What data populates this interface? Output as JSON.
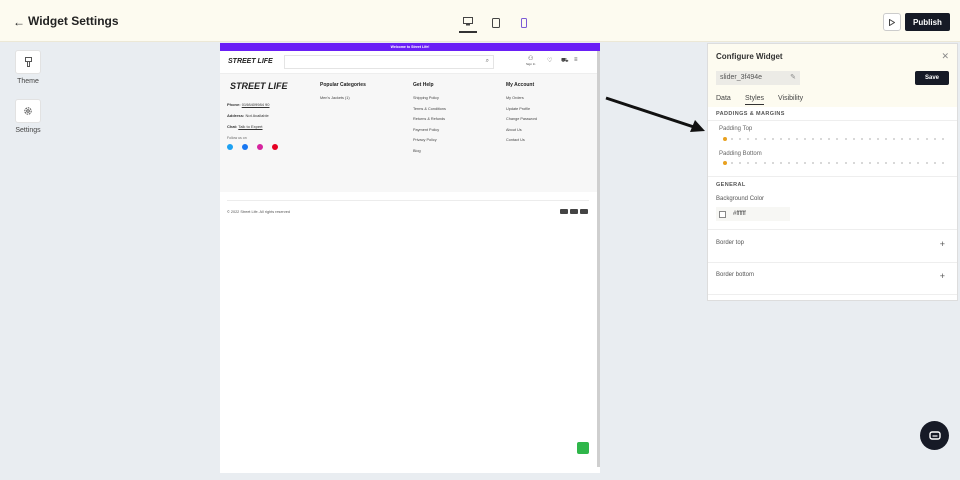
{
  "header": {
    "back_icon": "arrow-left-icon",
    "title": "Widget Settings",
    "publish_label": "Publish"
  },
  "devices": [
    "desktop-icon",
    "tablet-icon",
    "mobile-icon"
  ],
  "rail": {
    "theme_label": "Theme",
    "settings_label": "Settings"
  },
  "site": {
    "announcement": "Welcome to Street Life!",
    "logo": "STREET LIFE",
    "signin_label": "Sign In",
    "footer": {
      "logo": "STREET LIFE",
      "phone_label": "Phone:",
      "phone_value": "0198409984 90",
      "address_label": "Address:",
      "address_value": "Not Available",
      "chat_label": "Chat:",
      "chat_value": "Talk to Expert",
      "follow_label": "Follow us on",
      "columns": [
        {
          "title": "Popular Categories",
          "items": [
            "Men's Jackets (1)"
          ]
        },
        {
          "title": "Get Help",
          "items": [
            "Shipping Policy",
            "Terms & Conditions",
            "Returns & Refunds",
            "Payment Policy",
            "Privacy Policy",
            "Blog"
          ]
        },
        {
          "title": "My Account",
          "items": [
            "My Orders",
            "Update Profile",
            "Change Password",
            "About Us",
            "Contact Us"
          ]
        }
      ],
      "copyright": "© 2022 Street Life. All rights reserved"
    }
  },
  "panel": {
    "title": "Configure Widget",
    "widget_id": "slider_3f494e",
    "save_label": "Save",
    "tabs": [
      "Data",
      "Styles",
      "Visibility"
    ],
    "active_tab": "Styles",
    "paddings_heading": "PADDINGS & MARGINS",
    "padding_top_label": "Padding Top",
    "padding_bottom_label": "Padding Bottom",
    "padding_top_value": 0,
    "padding_bottom_value": 0,
    "general_heading": "GENERAL",
    "bg_color_label": "Background Color",
    "bg_color_value": "#ffffff",
    "border_top_label": "Border top",
    "border_bottom_label": "Border bottom"
  },
  "colors": {
    "accent": "#6a1ff6",
    "dark": "#161a26",
    "slider_knob": "#e8a120",
    "whatsapp": "#2fb64a"
  }
}
